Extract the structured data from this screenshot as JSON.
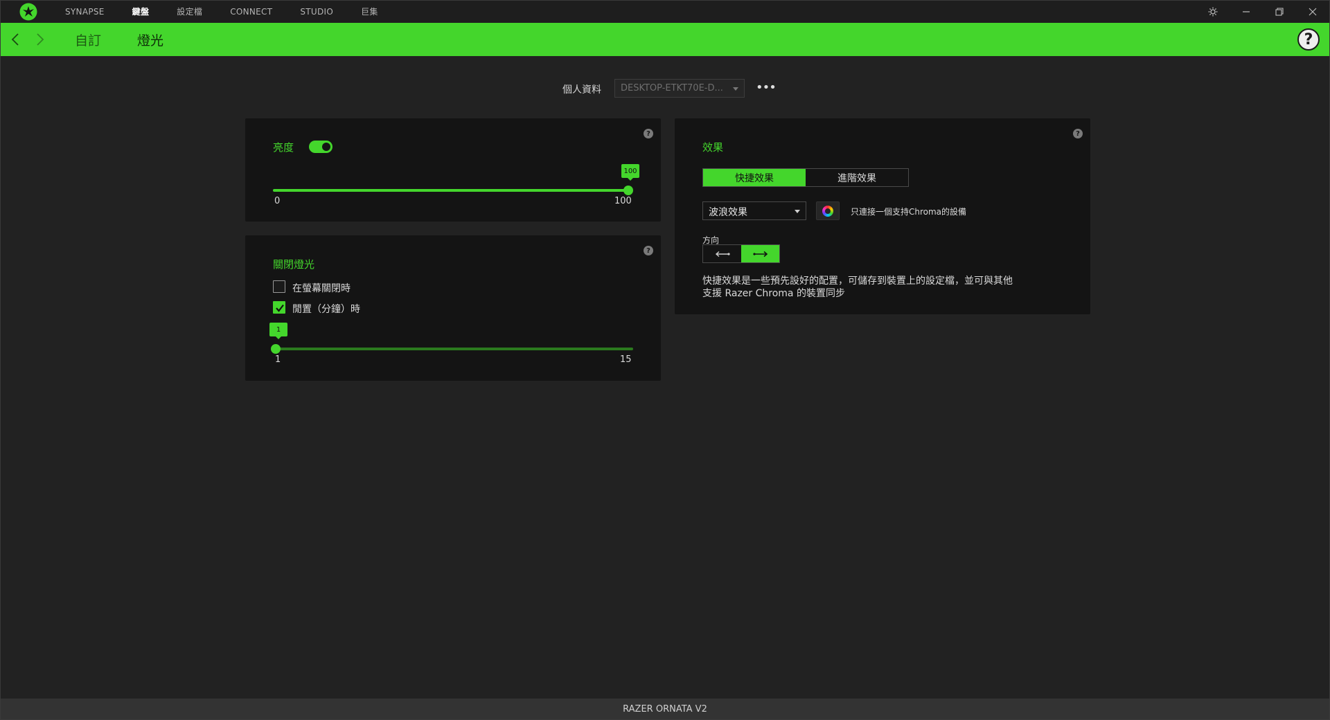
{
  "app": {
    "nav_tabs": [
      "SYNAPSE",
      "鍵盤",
      "設定檔",
      "CONNECT",
      "STUDIO",
      "巨集"
    ],
    "active_tab": "鍵盤"
  },
  "header": {
    "crumb1": "自訂",
    "crumb2": "燈光",
    "help": "?"
  },
  "profile": {
    "label": "個人資料",
    "value": "DESKTOP-ETKT70E-D...",
    "more": "•••"
  },
  "brightness": {
    "title": "亮度",
    "enabled": true,
    "value": 100,
    "value_label": "100",
    "min_label": "0",
    "max_label": "100",
    "min": 0,
    "max": 100
  },
  "lights_off": {
    "title": "關閉燈光",
    "option1": "在螢幕關閉時",
    "option1_checked": false,
    "option2": "閒置（分鐘）時",
    "option2_checked": true,
    "value": 1,
    "value_label": "1",
    "min_label": "1",
    "max_label": "15",
    "min": 1,
    "max": 15
  },
  "effects": {
    "title": "效果",
    "tab_quick": "快捷效果",
    "tab_advanced": "進階效果",
    "selected_effect": "波浪效果",
    "chroma_note": "只連接一個支持Chroma的設備",
    "direction_label": "方向",
    "description": "快捷效果是一些預先設好的配置，可儲存到裝置上的設定檔，並可與其他\n支援 Razer Chroma 的裝置同步"
  },
  "footer": {
    "device": "RAZER ORNATA V2"
  },
  "colors": {
    "accent": "#44d62c",
    "panel": "#141414",
    "background": "#222222"
  }
}
